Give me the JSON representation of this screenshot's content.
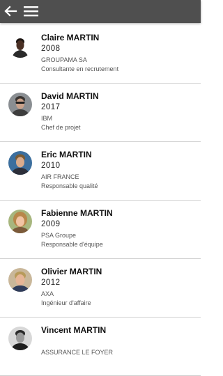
{
  "header": {
    "back_icon": "arrow-left-icon",
    "menu_icon": "hamburger-menu-icon",
    "background": "#4f4f4f"
  },
  "people": [
    {
      "name": "Claire MARTIN",
      "year": "2008",
      "company": "GROUPAMA SA",
      "role": "Consultante en recrutement"
    },
    {
      "name": "David MARTIN",
      "year": "2017",
      "company": "IBM",
      "role": "Chef de projet"
    },
    {
      "name": "Eric MARTIN",
      "year": "2010",
      "company": "AIR FRANCE",
      "role": "Responsable qualité"
    },
    {
      "name": "Fabienne MARTIN",
      "year": "2009",
      "company": "PSA Groupe",
      "role": "Responsable d'équipe"
    },
    {
      "name": "Olivier MARTIN",
      "year": "2012",
      "company": "AXA",
      "role": "Ingénieur d'affaire"
    },
    {
      "name": "Vincent MARTIN",
      "year": "",
      "company": "ASSURANCE LE FOYER",
      "role": ""
    }
  ]
}
